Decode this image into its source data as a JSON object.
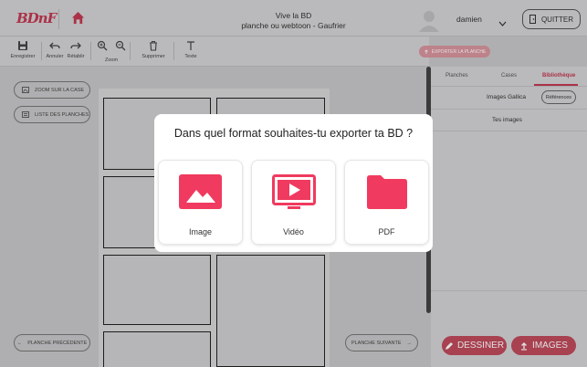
{
  "header": {
    "logo": "BDnF",
    "title_line1": "Vive la BD",
    "title_line2": "planche ou webtoon - Gaufrier",
    "username": "damien",
    "quit_label": "QUITTER"
  },
  "toolbar": {
    "tools": [
      {
        "label": "Enregistrer",
        "icon": "save-icon"
      },
      {
        "label": "Annuler",
        "icon": "undo-icon"
      },
      {
        "label": "Rétablir",
        "icon": "redo-icon"
      },
      {
        "label": "Zoom",
        "icon": "zoom-in-icon"
      },
      {
        "label": "Supprimer",
        "icon": "trash-icon"
      },
      {
        "label": "Texte",
        "icon": "text-icon"
      }
    ],
    "export_label": "EXPORTER LA PLANCHE"
  },
  "left_panel": {
    "zoom_case_label": "ZOOM SUR LA CASE",
    "list_planches_label": "LISTE DES PLANCHES",
    "prev_label": "PLANCHE PRÉCÉDENTE",
    "next_label": "PLANCHE SUIVANTE"
  },
  "right_panel": {
    "tabs": [
      {
        "label": "Planches",
        "active": false
      },
      {
        "label": "Cases",
        "active": false
      },
      {
        "label": "Bibliothèque",
        "active": true
      }
    ],
    "gallica_label": "Images Gallica",
    "references_label": "Références",
    "my_images_label": "Tes images",
    "draw_label": "DESSINER",
    "images_label": "IMAGES"
  },
  "modal": {
    "title": "Dans quel format souhaites-tu exporter ta BD ?",
    "options": [
      {
        "label": "Image",
        "icon": "image-icon"
      },
      {
        "label": "Vidéo",
        "icon": "video-icon"
      },
      {
        "label": "PDF",
        "icon": "folder-icon"
      }
    ]
  },
  "colors": {
    "accent": "#f03a5f",
    "brand": "#c23a52",
    "overlay_bg": "#c8c8ca"
  }
}
